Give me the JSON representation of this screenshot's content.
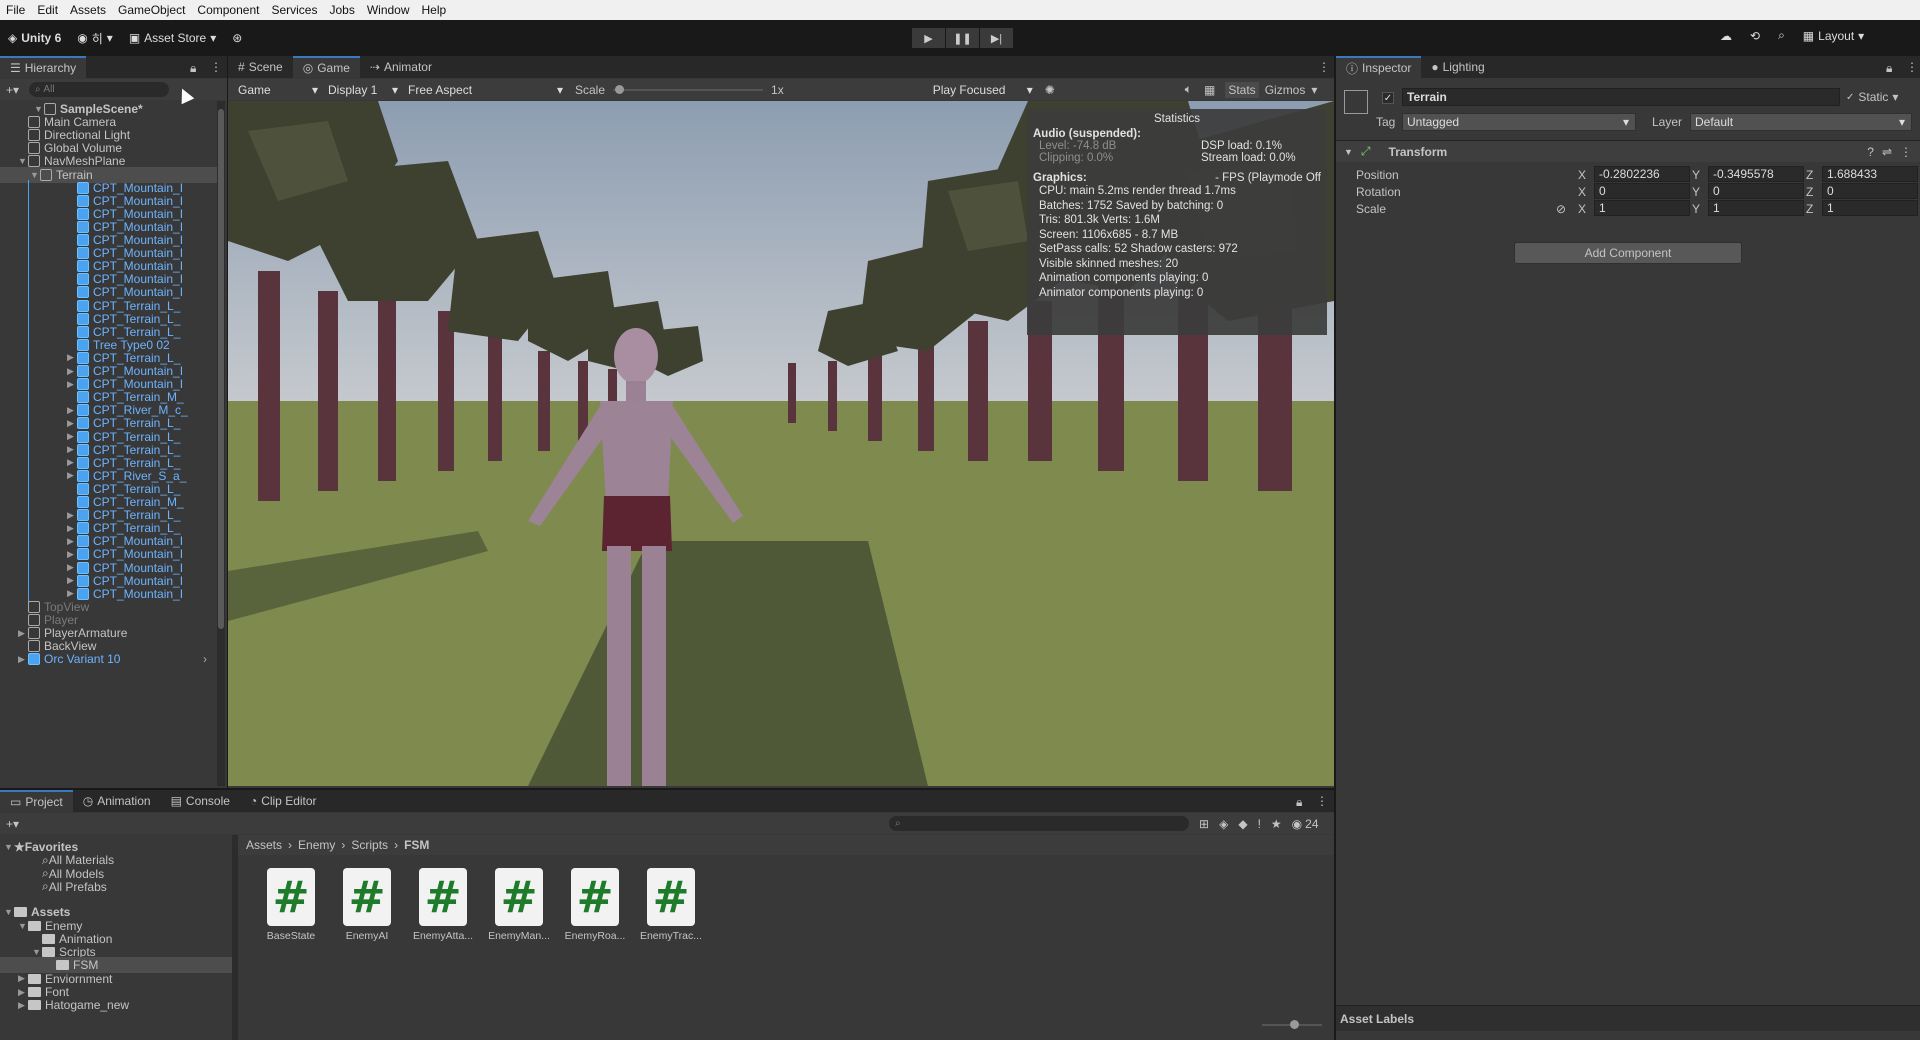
{
  "menu": [
    "File",
    "Edit",
    "Assets",
    "GameObject",
    "Component",
    "Services",
    "Jobs",
    "Window",
    "Help"
  ],
  "toolbar": {
    "app": "Unity 6",
    "account": "히",
    "asset_store": "Asset Store",
    "layout": "Layout"
  },
  "hierarchy": {
    "tab": "Hierarchy",
    "search_placeholder": "All",
    "rows": [
      {
        "label": "SampleScene*",
        "indent": 0,
        "kind": "scene",
        "caret": "▼"
      },
      {
        "label": "Main Camera",
        "indent": 1,
        "kind": "obj"
      },
      {
        "label": "Directional Light",
        "indent": 1,
        "kind": "obj"
      },
      {
        "label": "Global Volume",
        "indent": 1,
        "kind": "obj"
      },
      {
        "label": "NavMeshPlane",
        "indent": 1,
        "kind": "obj",
        "caret": "▼"
      },
      {
        "label": "Terrain",
        "indent": 2,
        "kind": "obj",
        "caret": "▼",
        "selected": true
      },
      {
        "label": "CPT_Mountain_I",
        "indent": 3,
        "kind": "blue",
        "arrow": true
      },
      {
        "label": "CPT_Mountain_I",
        "indent": 3,
        "kind": "blue",
        "arrow": true
      },
      {
        "label": "CPT_Mountain_I",
        "indent": 3,
        "kind": "blue",
        "arrow": true
      },
      {
        "label": "CPT_Mountain_I",
        "indent": 3,
        "kind": "blue",
        "arrow": true
      },
      {
        "label": "CPT_Mountain_I",
        "indent": 3,
        "kind": "blue",
        "arrow": true
      },
      {
        "label": "CPT_Mountain_I",
        "indent": 3,
        "kind": "blue",
        "arrow": true
      },
      {
        "label": "CPT_Mountain_I",
        "indent": 3,
        "kind": "blue",
        "arrow": true
      },
      {
        "label": "CPT_Mountain_I",
        "indent": 3,
        "kind": "blue",
        "arrow": true
      },
      {
        "label": "CPT_Mountain_I",
        "indent": 3,
        "kind": "blue",
        "arrow": true
      },
      {
        "label": "CPT_Terrain_L_",
        "indent": 3,
        "kind": "blue",
        "arrow": true
      },
      {
        "label": "CPT_Terrain_L_",
        "indent": 3,
        "kind": "blue",
        "arrow": true
      },
      {
        "label": "CPT_Terrain_L_",
        "indent": 3,
        "kind": "blue",
        "arrow": true
      },
      {
        "label": "Tree Type0 02",
        "indent": 3,
        "kind": "blue",
        "arrow": true
      },
      {
        "label": "CPT_Terrain_L_",
        "indent": 3,
        "kind": "blue",
        "arrow": true,
        "caret": "▶"
      },
      {
        "label": "CPT_Mountain_I",
        "indent": 3,
        "kind": "blue",
        "arrow": true,
        "caret": "▶"
      },
      {
        "label": "CPT_Mountain_I",
        "indent": 3,
        "kind": "blue",
        "arrow": true,
        "caret": "▶"
      },
      {
        "label": "CPT_Terrain_M_",
        "indent": 3,
        "kind": "blue",
        "arrow": true
      },
      {
        "label": "CPT_River_M_c_",
        "indent": 3,
        "kind": "blue",
        "arrow": true,
        "caret": "▶"
      },
      {
        "label": "CPT_Terrain_L_",
        "indent": 3,
        "kind": "blue",
        "arrow": true,
        "caret": "▶"
      },
      {
        "label": "CPT_Terrain_L_",
        "indent": 3,
        "kind": "blue",
        "arrow": true,
        "caret": "▶"
      },
      {
        "label": "CPT_Terrain_L_",
        "indent": 3,
        "kind": "blue",
        "arrow": true,
        "caret": "▶"
      },
      {
        "label": "CPT_Terrain_L_",
        "indent": 3,
        "kind": "blue",
        "arrow": true,
        "caret": "▶"
      },
      {
        "label": "CPT_River_S_a_",
        "indent": 3,
        "kind": "blue",
        "arrow": true,
        "caret": "▶"
      },
      {
        "label": "CPT_Terrain_L_",
        "indent": 3,
        "kind": "blue",
        "arrow": true
      },
      {
        "label": "CPT_Terrain_M_",
        "indent": 3,
        "kind": "blue",
        "arrow": true
      },
      {
        "label": "CPT_Terrain_L_",
        "indent": 3,
        "kind": "blue",
        "arrow": true,
        "caret": "▶"
      },
      {
        "label": "CPT_Terrain_L_",
        "indent": 3,
        "kind": "blue",
        "arrow": true,
        "caret": "▶"
      },
      {
        "label": "CPT_Mountain_I",
        "indent": 3,
        "kind": "blue",
        "arrow": true,
        "caret": "▶"
      },
      {
        "label": "CPT_Mountain_I",
        "indent": 3,
        "kind": "blue",
        "arrow": true,
        "caret": "▶"
      },
      {
        "label": "CPT_Mountain_I",
        "indent": 3,
        "kind": "blue",
        "arrow": true,
        "caret": "▶"
      },
      {
        "label": "CPT_Mountain_I",
        "indent": 3,
        "kind": "blue",
        "arrow": true,
        "caret": "▶"
      },
      {
        "label": "CPT_Mountain_I",
        "indent": 3,
        "kind": "blue",
        "arrow": true,
        "caret": "▶"
      },
      {
        "label": "TopView",
        "indent": 1,
        "kind": "dim"
      },
      {
        "label": "Player",
        "indent": 1,
        "kind": "dim"
      },
      {
        "label": "PlayerArmature",
        "indent": 1,
        "kind": "obj",
        "caret": "▶"
      },
      {
        "label": "BackView",
        "indent": 1,
        "kind": "obj"
      },
      {
        "label": "Orc Variant 10",
        "indent": 1,
        "kind": "blue",
        "arrow": true,
        "caret": "▶"
      }
    ]
  },
  "center_tabs": [
    "Scene",
    "Game",
    "Animator"
  ],
  "game_bar": {
    "mode": "Game",
    "display": "Display 1",
    "aspect": "Free Aspect",
    "scale_label": "Scale",
    "scale_value": "1x",
    "play_focused": "Play Focused",
    "stats": "Stats",
    "gizmos": "Gizmos"
  },
  "stats": {
    "title": "Statistics",
    "audio_h": "Audio (suspended):",
    "level": "Level: -74.8 dB",
    "dsp": "DSP load: 0.1%",
    "clipping": "Clipping: 0.0%",
    "stream": "Stream load: 0.0%",
    "graphics_h": "Graphics:",
    "fps": "- FPS (Playmode Off",
    "lines": [
      "CPU: main 5.2ms  render thread 1.7ms",
      "Batches: 1752   Saved by batching: 0",
      "Tris: 801.3k     Verts: 1.6M",
      "Screen: 1106x685 - 8.7 MB",
      "SetPass calls: 52     Shadow casters: 972",
      "Visible skinned meshes: 20",
      "Animation components playing: 0",
      "Animator components playing: 0"
    ]
  },
  "inspector": {
    "tabs": [
      "Inspector",
      "Lighting"
    ],
    "object_name": "Terrain",
    "static_label": "Static",
    "tag_label": "Tag",
    "tag_value": "Untagged",
    "layer_label": "Layer",
    "layer_value": "Default",
    "component": "Transform",
    "rows": [
      {
        "label": "Position",
        "x": "-0.2802236",
        "y": "-0.3495578",
        "z": "1.688433"
      },
      {
        "label": "Rotation",
        "x": "0",
        "y": "0",
        "z": "0"
      },
      {
        "label": "Scale",
        "x": "1",
        "y": "1",
        "z": "1"
      }
    ],
    "add_component": "Add Component",
    "asset_labels": "Asset Labels"
  },
  "bottom_tabs": [
    "Project",
    "Animation",
    "Console",
    "Clip Editor"
  ],
  "project": {
    "favorites": "Favorites",
    "fav_items": [
      "All Materials",
      "All Models",
      "All Prefabs"
    ],
    "assets": "Assets",
    "tree": [
      {
        "label": "Enemy",
        "indent": 1,
        "caret": "▼"
      },
      {
        "label": "Animation",
        "indent": 2
      },
      {
        "label": "Scripts",
        "indent": 2,
        "caret": "▼"
      },
      {
        "label": "FSM",
        "indent": 3,
        "selected": true
      },
      {
        "label": "Enviornment",
        "indent": 1,
        "caret": "▶"
      },
      {
        "label": "Font",
        "indent": 1,
        "caret": "▶"
      },
      {
        "label": "Hatogame_new",
        "indent": 1,
        "caret": "▶"
      }
    ],
    "breadcrumb": [
      "Assets",
      "Enemy",
      "Scripts",
      "FSM"
    ],
    "count": "24",
    "files": [
      "BaseState",
      "EnemyAI",
      "EnemyAtta...",
      "EnemyMan...",
      "EnemyRoa...",
      "EnemyTrac..."
    ]
  }
}
